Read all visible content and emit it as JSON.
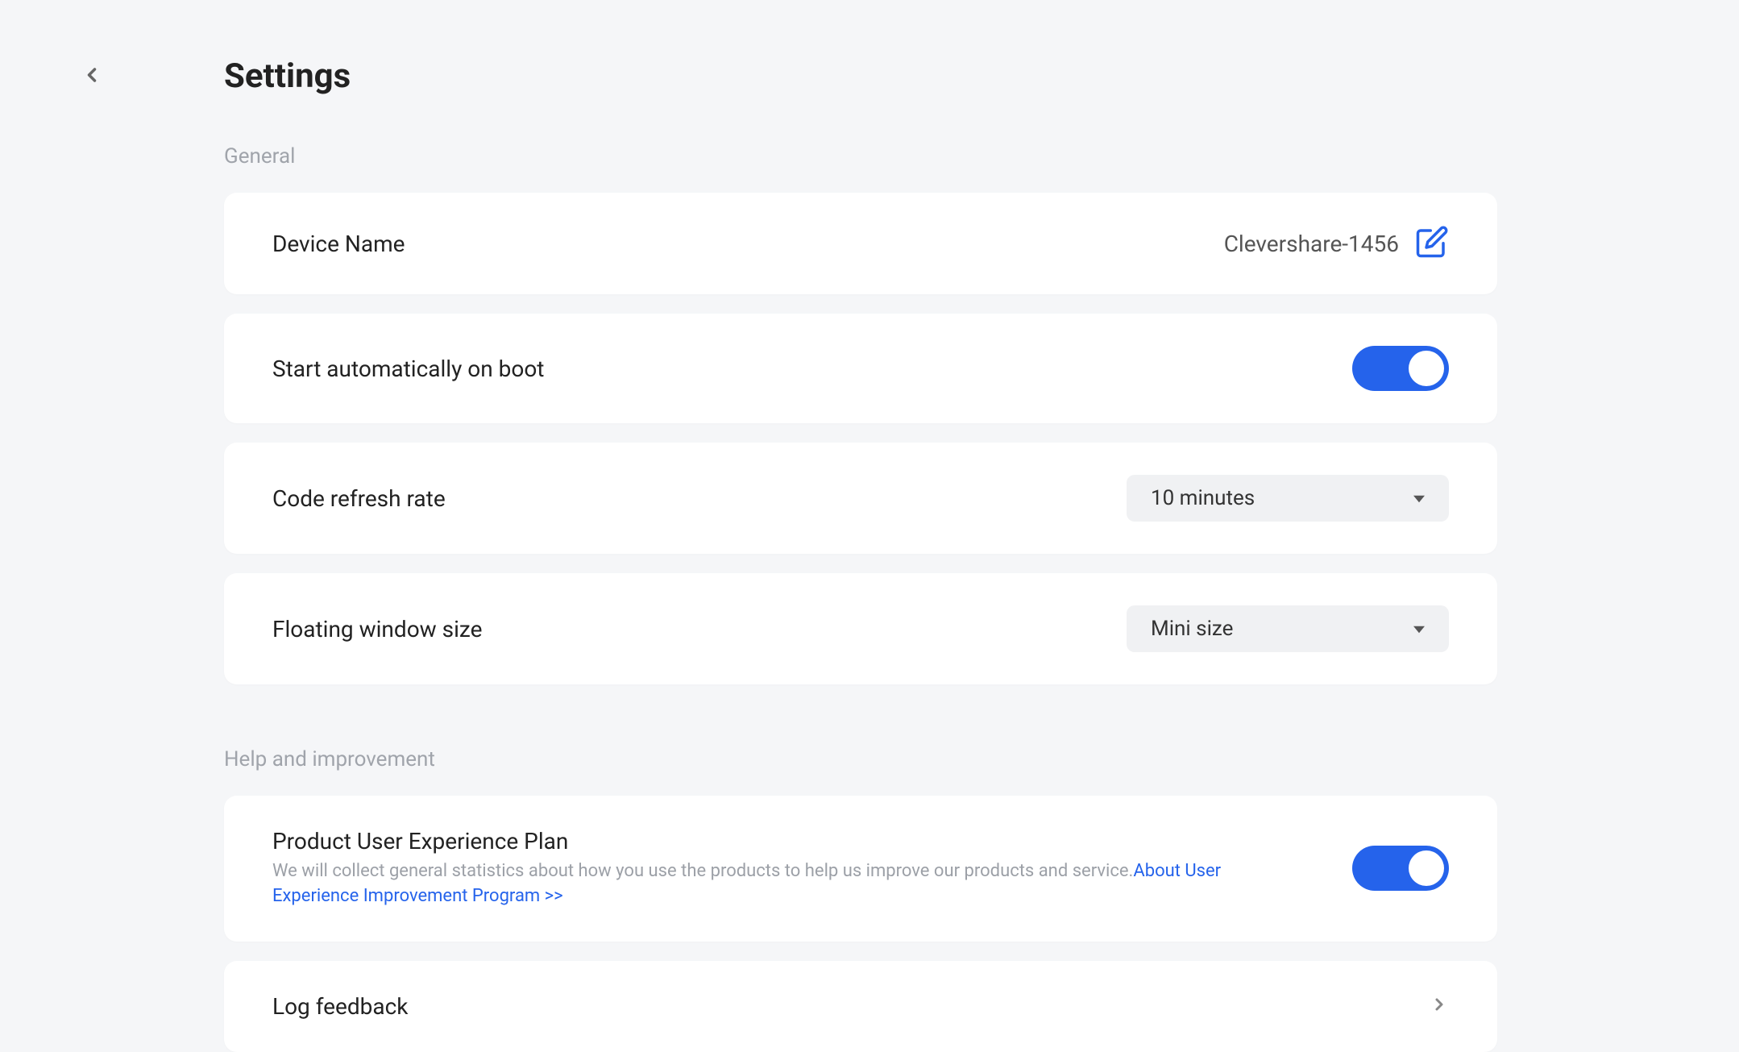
{
  "header": {
    "title": "Settings"
  },
  "sections": {
    "general": {
      "label": "General",
      "deviceName": {
        "label": "Device Name",
        "value": "Clevershare-1456"
      },
      "autoStart": {
        "label": "Start automatically on boot"
      },
      "codeRefresh": {
        "label": "Code refresh rate",
        "value": "10 minutes"
      },
      "floatingWindow": {
        "label": "Floating window size",
        "value": "Mini size"
      }
    },
    "help": {
      "label": "Help and improvement",
      "uxPlan": {
        "label": "Product User Experience Plan",
        "description": "We will collect general statistics about how you use the products to help us improve our products and service.",
        "linkText": "About User Experience Improvement Program >>"
      },
      "logFeedback": {
        "label": "Log feedback"
      }
    }
  }
}
